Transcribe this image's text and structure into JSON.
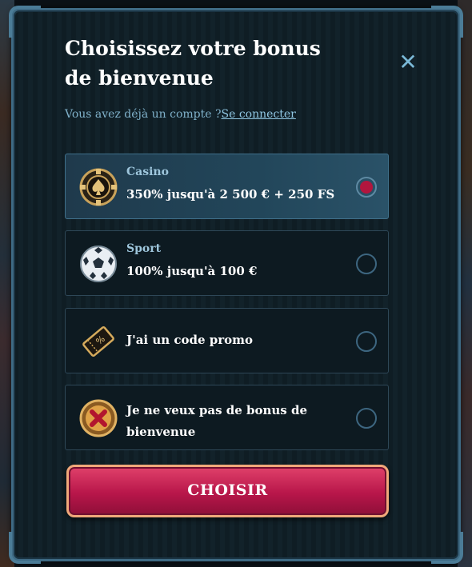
{
  "modal": {
    "title": "Choisissez votre bonus de bienvenue",
    "close_label": "✕",
    "subtitle_text": "Vous avez déjà un compte ?",
    "login_link": "Se connecter"
  },
  "options": [
    {
      "category": "Casino",
      "text": "350% jusqu'à 2 500 € + 250 FS",
      "selected": true,
      "icon": "casino-chip-icon"
    },
    {
      "category": "Sport",
      "text": "100% jusqu'à 100 €",
      "selected": false,
      "icon": "soccer-ball-icon"
    },
    {
      "category": "",
      "text": "J'ai un code promo",
      "selected": false,
      "icon": "promo-ticket-icon"
    },
    {
      "category": "",
      "text": "Je ne veux pas de bonus de bienvenue",
      "selected": false,
      "icon": "no-bonus-icon"
    }
  ],
  "cta": {
    "label": "CHOISIR"
  },
  "colors": {
    "accent": "#b2163e",
    "link": "#8fc6e2",
    "frame": "#3e6a84"
  }
}
